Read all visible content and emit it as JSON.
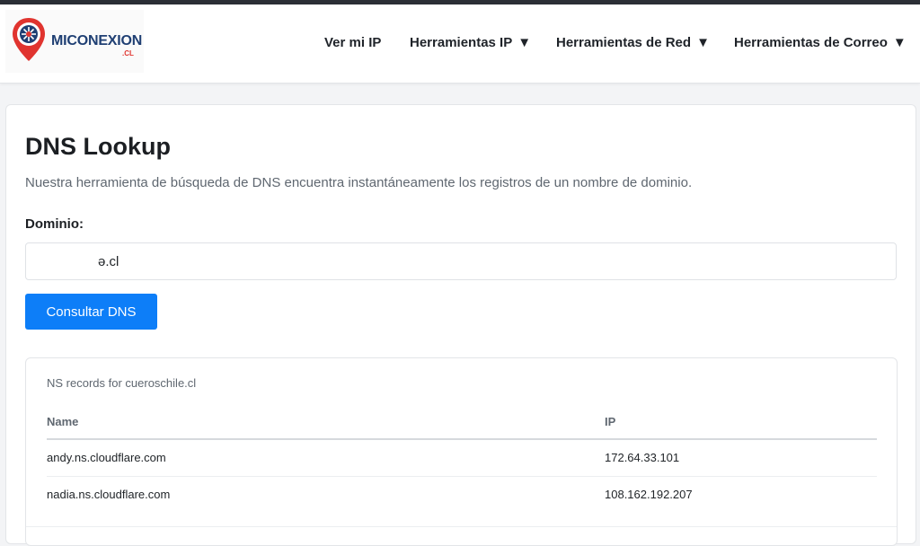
{
  "header": {
    "logo": {
      "text": "MICONEXION",
      "tld": ".CL",
      "icon": "logo-pin-icon",
      "colors": {
        "navy": "#1f3f73",
        "red": "#e0342f"
      }
    },
    "nav": [
      {
        "label": "Ver mi IP",
        "has_dropdown": false
      },
      {
        "label": "Herramientas IP",
        "has_dropdown": true
      },
      {
        "label": "Herramientas de Red",
        "has_dropdown": true
      },
      {
        "label": "Herramientas de Correo",
        "has_dropdown": true
      }
    ],
    "dropdown_glyph": "▼"
  },
  "main": {
    "title": "DNS Lookup",
    "description": "Nuestra herramienta de búsqueda de DNS encuentra instantáneamente los registros de un nombre de dominio.",
    "form": {
      "domain_label": "Dominio:",
      "domain_value": "ə.cl",
      "submit_label": "Consultar DNS",
      "submit_color": "#0d7ef8"
    },
    "results": {
      "caption": "NS records for cueroschile.cl",
      "columns": [
        "Name",
        "IP"
      ],
      "rows": [
        {
          "name": "andy.ns.cloudflare.com",
          "ip": "172.64.33.101"
        },
        {
          "name": "nadia.ns.cloudflare.com",
          "ip": "108.162.192.207"
        }
      ]
    }
  }
}
